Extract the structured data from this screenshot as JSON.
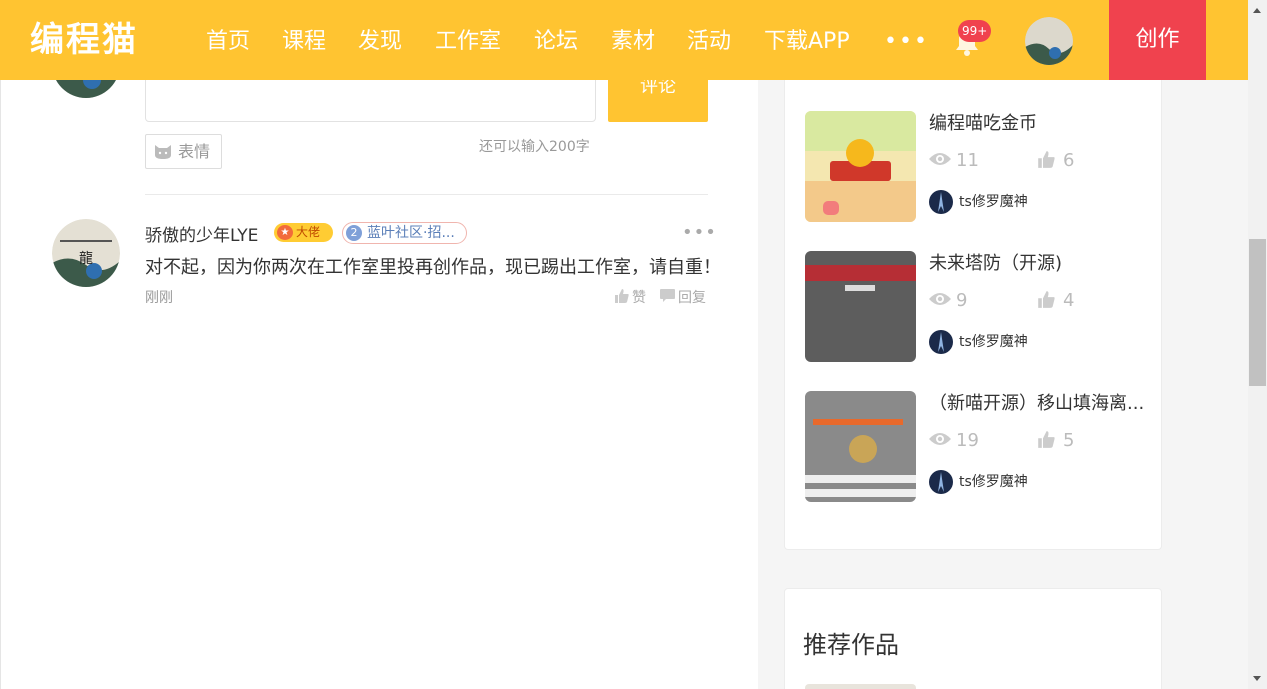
{
  "header": {
    "logo": "编程猫",
    "nav": [
      "首页",
      "课程",
      "发现",
      "工作室",
      "论坛",
      "素材",
      "活动",
      "下载APP"
    ],
    "more": "•••",
    "notification_count": "99+",
    "create_label": "创作",
    "colors": {
      "bar": "#ffc431",
      "create": "#f0424e",
      "badge": "#f0424e"
    }
  },
  "comment_form": {
    "submit_label": "评论",
    "emoji_label": "表情",
    "char_limit": "还可以输入200字"
  },
  "comment": {
    "author": "骄傲的少年LYE",
    "badge": "大佬",
    "level": "2",
    "community": "蓝叶社区·招...",
    "text": "对不起，因为你两次在工作室里投再创作品，现已踢出工作室，请自重！",
    "time": "刚刚",
    "like_label": "赞",
    "reply_label": "回复"
  },
  "sidebar": {
    "works": [
      {
        "title": "编程喵吃金币",
        "views": "11",
        "likes": "6",
        "author": "ts修罗魔神",
        "thumb": "coin-game-thumbnail"
      },
      {
        "title": "未来塔防（开源)",
        "views": "9",
        "likes": "4",
        "author": "ts修罗魔神",
        "thumb": "tower-defense-thumbnail"
      },
      {
        "title": "（新喵开源）移山填海离...",
        "views": "19",
        "likes": "5",
        "author": "ts修罗魔神",
        "thumb": "clicker-game-thumbnail"
      }
    ],
    "recommended_title": "推荐作品"
  }
}
